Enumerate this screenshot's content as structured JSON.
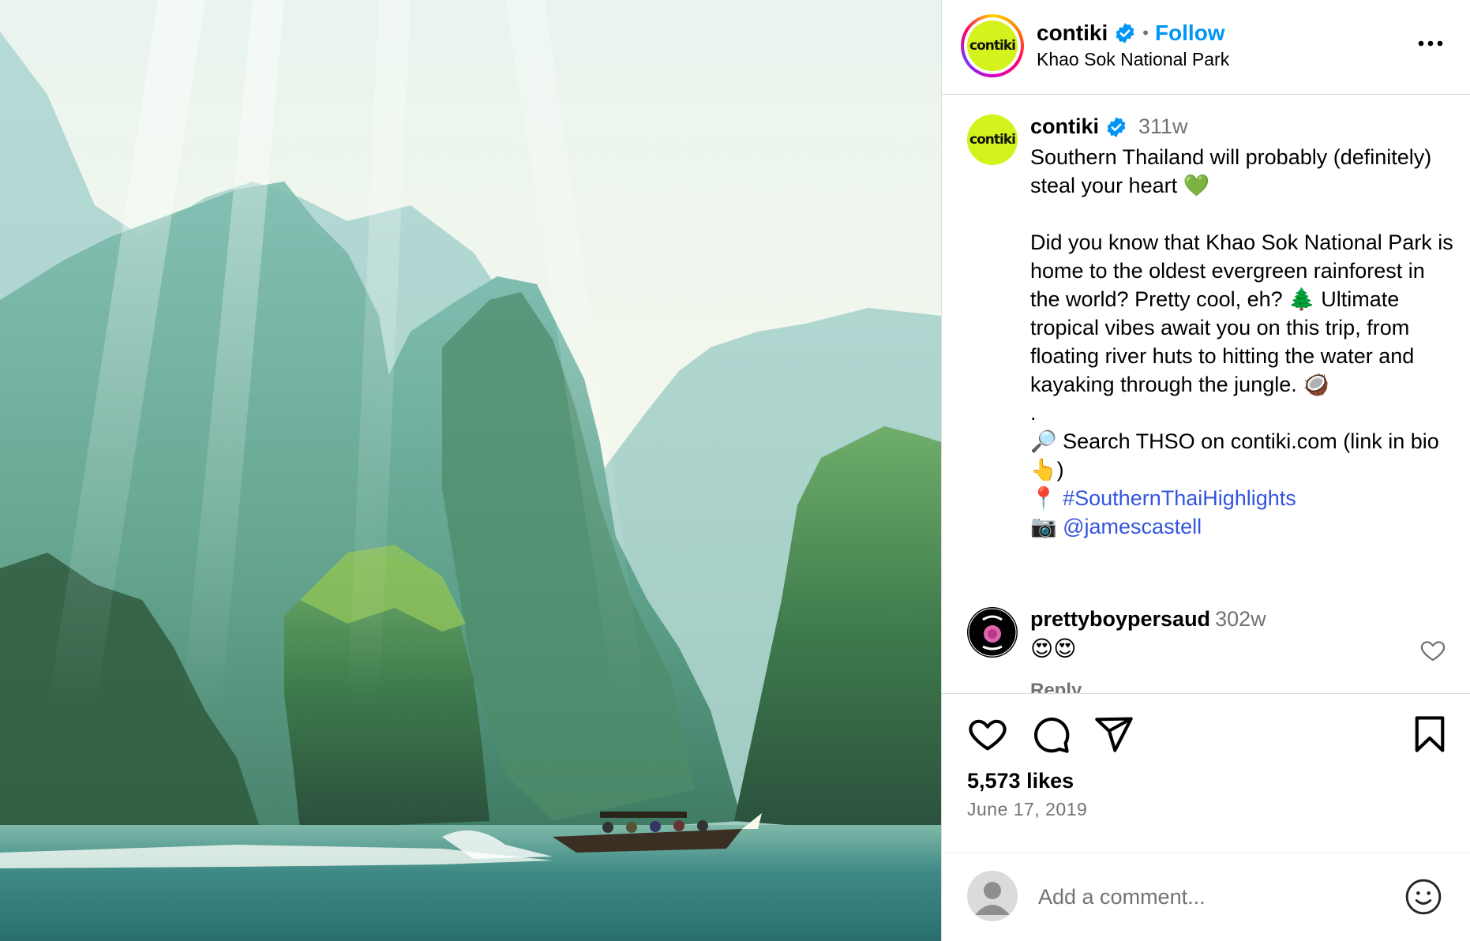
{
  "post": {
    "username": "contiki",
    "location": "Khao Sok National Park",
    "follow_label": "Follow",
    "separator": "•",
    "avatar_text": "contiki"
  },
  "caption": {
    "username": "contiki",
    "age": "311w",
    "text_main": "Southern Thailand will probably (definitely) steal your heart 💚\n\nDid you know that Khao Sok National Park is home to the oldest evergreen rainforest in the world? Pretty cool, eh? 🌲 Ultimate tropical vibes await you on this trip, from floating river huts to hitting the water and kayaking through the jungle. 🥥\n.\n🔎 Search THSO on contiki.com (link in bio👆)\n",
    "hashtag_prefix": "📍 ",
    "hashtag": "#SouthernThaiHighlights",
    "mention_prefix": "📷 ",
    "mention": "@jamescastell"
  },
  "comment": {
    "username": "prettyboypersaud",
    "age": "302w",
    "text": "😍😍",
    "reply_label": "Reply"
  },
  "stats": {
    "likes": "5,573 likes",
    "date": "June 17, 2019"
  },
  "add_comment": {
    "placeholder": "Add a comment..."
  },
  "icons": {
    "more": "more-options-icon",
    "verified": "verified-badge-icon",
    "like": "heart-icon",
    "comment": "comment-icon",
    "share": "share-icon",
    "save": "bookmark-icon",
    "emoji": "emoji-icon"
  },
  "colors": {
    "accent": "#0095f6",
    "link": "#3355dd",
    "muted": "#737373",
    "brand_avatar": "#d4f21c"
  }
}
